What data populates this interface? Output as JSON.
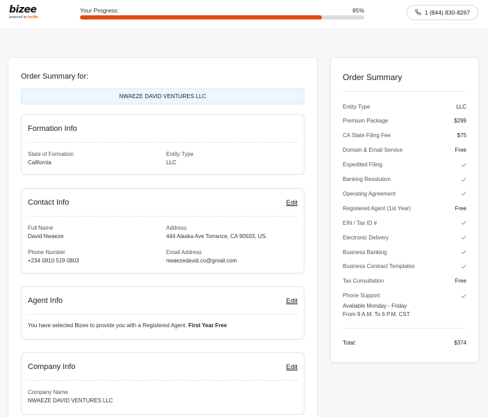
{
  "header": {
    "logo": {
      "name": "bizee",
      "tagline_prefix": "powered by",
      "tagline_brand": "incfile"
    },
    "progress": {
      "label": "Your Progress:",
      "percent_text": "85%",
      "value": 0.85
    },
    "phone": "1 (844) 830-8267"
  },
  "summary": {
    "title": "Order Summary for:",
    "company_name": "NWAEZE DAVID VENTURES LLC",
    "formation": {
      "title": "Formation Info",
      "state_label": "State of Formation",
      "state_value": "California",
      "entity_label": "Entity Type",
      "entity_value": "LLC"
    },
    "contact": {
      "title": "Contact Info",
      "edit": "Edit",
      "name_label": "Full Name",
      "name_value": "David Nwaeze",
      "address_label": "Address",
      "address_value": "444 Alaska Ave Torrance, CA 90503, US.",
      "phone_label": "Phone Number",
      "phone_value": "+234 0810 519 0803",
      "email_label": "Email Address",
      "email_value": "nwaezedavid.co@gmail.com"
    },
    "agent": {
      "title": "Agent Info",
      "edit": "Edit",
      "text": "You have selected Bizee to provide you with a Registered Agent.",
      "highlight": "First Year Free"
    },
    "company": {
      "title": "Company Info",
      "edit": "Edit",
      "name_label": "Company Name",
      "name_value": "NWAEZE DAVID VENTURES LLC"
    }
  },
  "order": {
    "title": "Order Summary",
    "items": [
      {
        "label": "Entity Type",
        "value": "LLC"
      },
      {
        "label": "Premium Package",
        "value": "$299"
      },
      {
        "label": "CA State Filing Fee",
        "value": "$75"
      },
      {
        "label": "Domain & Email Service",
        "value": "Free"
      },
      {
        "label": "Expedited Filing",
        "value": ""
      },
      {
        "label": "Banking Resolution",
        "value": ""
      },
      {
        "label": "Operating Agreement",
        "value": ""
      },
      {
        "label": "Registered Agent (1st Year)",
        "value": "Free"
      },
      {
        "label": "EIN / Tax ID #",
        "value": ""
      },
      {
        "label": "Electronic Delivery",
        "value": ""
      },
      {
        "label": "Business Banking",
        "value": ""
      },
      {
        "label": "Business Contract Templates",
        "value": ""
      },
      {
        "label": "Tax Consultation",
        "value": "Free"
      },
      {
        "label": "Phone Support",
        "value": ""
      }
    ],
    "phone_support_hours": [
      "Available Monday - Friday",
      "From 9 A.M. To 6 P.M. CST"
    ],
    "total_label": "Total:",
    "total_value": "$374"
  },
  "colors": {
    "accent": "#dd4d0e",
    "banner": "#eef6fb"
  }
}
